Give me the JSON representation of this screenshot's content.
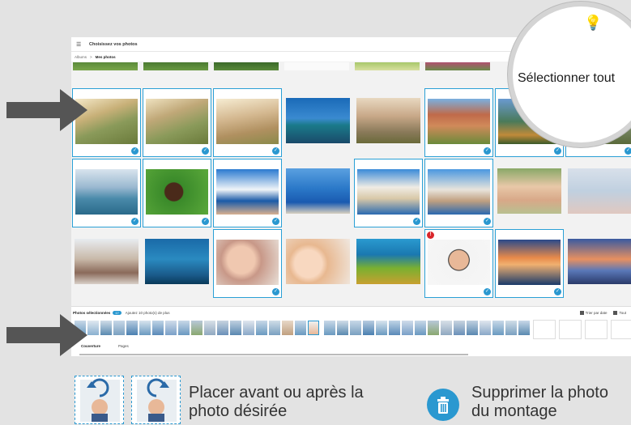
{
  "header": {
    "menu_icon": "hamburger-icon",
    "title": "Choisissez vos photos"
  },
  "breadcrumb": {
    "root": "Albums",
    "separator": ">",
    "current": "Mes photos"
  },
  "magnifier": {
    "select_all_label": "Sélectionner tout"
  },
  "selection_bar": {
    "title": "Photos sélectionnées",
    "count": "17",
    "add_more_label": "Ajoutez 10 photo(s) de plus",
    "sort_label": "Trier par date",
    "delete_all_label": "Tout",
    "tabs": [
      "Couverture",
      "Pages"
    ]
  },
  "legend": {
    "placement_text_line1": "Placer avant ou après la",
    "placement_text_line2": "photo désirée",
    "delete_text_line1": "Supprimer la photo",
    "delete_text_line2": "du montage"
  },
  "photos": [
    {
      "scene": "grandfather-child-field",
      "selected": true
    },
    {
      "scene": "grandfather-child-field-2",
      "selected": true
    },
    {
      "scene": "child-path-field",
      "selected": true
    },
    {
      "scene": "bridge-blue-sky",
      "selected": false
    },
    {
      "scene": "couple-field",
      "selected": false
    },
    {
      "scene": "arcade-garden",
      "selected": true
    },
    {
      "scene": "mountain-lake",
      "selected": true
    },
    {
      "scene": "cropped-landscape",
      "selected": true
    },
    {
      "scene": "boat-sea",
      "selected": true
    },
    {
      "scene": "bear-grass",
      "selected": true
    },
    {
      "scene": "couple-santorini",
      "selected": true
    },
    {
      "scene": "santorini-coast",
      "selected": false
    },
    {
      "scene": "santorini-village",
      "selected": true
    },
    {
      "scene": "santorini-houses",
      "selected": true
    },
    {
      "scene": "mother-baby",
      "selected": false
    },
    {
      "scene": "baby-blanket",
      "selected": false
    },
    {
      "scene": "father-baby",
      "selected": false
    },
    {
      "scene": "diver",
      "selected": false
    },
    {
      "scene": "newborn",
      "selected": true
    },
    {
      "scene": "mother-kiss-baby",
      "selected": false
    },
    {
      "scene": "coral-reef",
      "selected": false
    },
    {
      "scene": "boy-glasses",
      "selected": true,
      "warning": true
    },
    {
      "scene": "beach-sunset-couple",
      "selected": true
    },
    {
      "scene": "sunset-lake",
      "selected": false
    }
  ],
  "colors": {
    "accent": "#2a98d0",
    "warning": "#d9262b",
    "arrow": "#555555"
  }
}
